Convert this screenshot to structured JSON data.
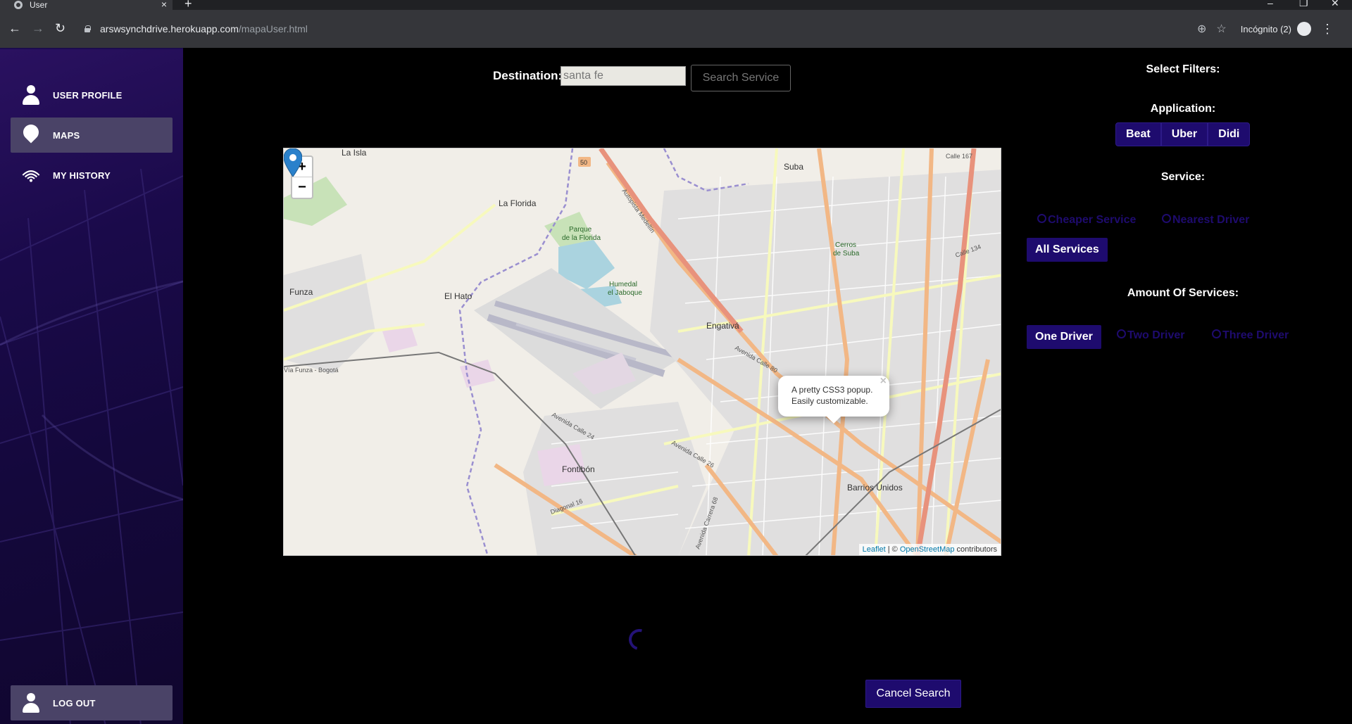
{
  "browser": {
    "tab_title": "User",
    "new_tab": "+",
    "tab_close": "×",
    "url_host": "arswsynchdrive.herokuapp.com",
    "url_path": "/mapaUser.html",
    "incognito_label": "Incógnito (2)",
    "back": "←",
    "forward": "→",
    "reload": "↻",
    "minimize": "–",
    "maximize": "❐",
    "close": "✕",
    "location_icon": "⊕",
    "star_icon": "☆",
    "menu": "⋮"
  },
  "sidebar": {
    "items": [
      {
        "label": "USER PROFILE",
        "icon": "person-icon"
      },
      {
        "label": "MAPS",
        "icon": "pin-icon",
        "active": true
      },
      {
        "label": "MY HISTORY",
        "icon": "signal-icon"
      }
    ],
    "logout_label": "LOG OUT"
  },
  "search": {
    "destination_label": "Destination:",
    "destination_value": "santa fe",
    "search_button": "Search Service"
  },
  "map": {
    "zoom_in": "+",
    "zoom_out": "−",
    "popup_line1": "A pretty CSS3 popup.",
    "popup_line2": "Easily customizable.",
    "popup_close": "×",
    "attribution_leaflet": "Leaflet",
    "attribution_sep": " | © ",
    "attribution_osm": "OpenStreetMap",
    "attribution_suffix": " contributors",
    "place_labels": [
      "La Isla",
      "Suba",
      "La Florida",
      "Parque de la Florida",
      "Funza",
      "El Hato",
      "Engativá",
      "Fontibón",
      "Barrios Unidos",
      "Humedal el Jaboque",
      "Cerros de Suba"
    ],
    "road_labels": [
      "50",
      "Calle 167",
      "Avenida Calle 80",
      "Autopista Medellín",
      "Vía Funza - Bogotá",
      "Avenida Calle 26",
      "Avenida Calle 24",
      "Diagonal 16",
      "Avenida Carrera 68",
      "Calle 134"
    ]
  },
  "filters": {
    "title": "Select Filters:",
    "application_title": "Application:",
    "applications": [
      "Beat",
      "Uber",
      "Didi"
    ],
    "service_title": "Service:",
    "service_options": [
      "Cheaper Service",
      "Nearest Driver"
    ],
    "all_services": "All Services",
    "amount_title": "Amount Of Services:",
    "one_driver": "One Driver",
    "amount_options": [
      "Two Driver",
      "Three Driver"
    ]
  },
  "actions": {
    "cancel_search": "Cancel Search"
  },
  "colors": {
    "accent": "#1e0b6e",
    "sidebar": "#1a0a4a",
    "background": "#000000"
  }
}
